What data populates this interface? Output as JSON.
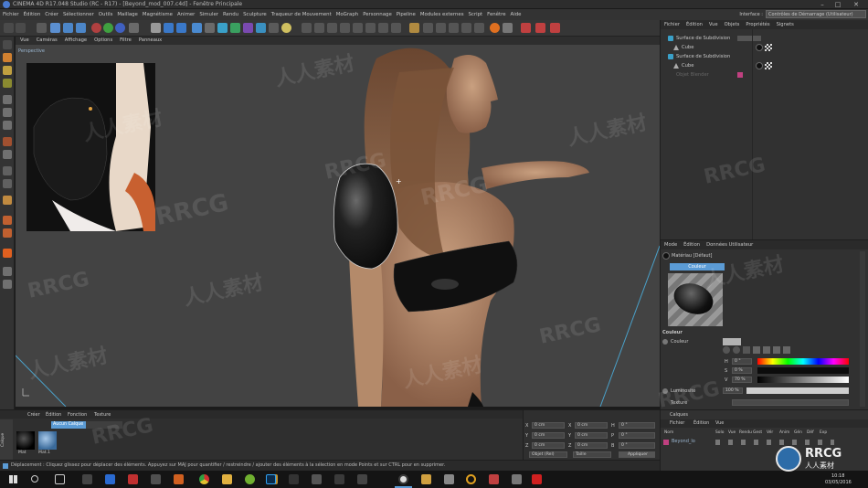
{
  "window": {
    "title": "CINEMA 4D R17.048 Studio (RC - R17) - [Beyond_mod_007.c4d] - Fenêtre Principale",
    "minimize": "–",
    "maximize": "□",
    "close": "✕"
  },
  "menu": {
    "items": [
      "Fichier",
      "Édition",
      "Créer",
      "Sélectionner",
      "Outils",
      "Maillage",
      "Magnétisme",
      "Animer",
      "Simuler",
      "Rendu",
      "Sculpture",
      "Traqueur de Mouvement",
      "MoGraph",
      "Personnage",
      "Pipeline",
      "Modules externes",
      "Script",
      "Fenêtre",
      "Aide"
    ],
    "interface_label": "Interface :",
    "interface_value": "Contrôles de Démarrage (Utilisateur)"
  },
  "viewport": {
    "menu": [
      "Vue",
      "Caméras",
      "Affichage",
      "Options",
      "Filtre",
      "Panneaux"
    ],
    "label": "Perspective"
  },
  "object_manager": {
    "tabs": [
      "Fichier",
      "Édition",
      "Vue",
      "Objets",
      "Propriétés",
      "Signets"
    ],
    "rows": [
      {
        "name": "Surface de Subdivision",
        "indent": 0
      },
      {
        "name": "Cube",
        "indent": 1
      },
      {
        "name": "Surface de Subdivision",
        "indent": 0
      },
      {
        "name": "Cube",
        "indent": 1
      },
      {
        "name": "Objet Blender",
        "indent": 0
      }
    ]
  },
  "attribute_manager": {
    "tabs": [
      "Mode",
      "Édition",
      "Données Utilisateur"
    ],
    "material_name": "Matériau [Défaut]",
    "channel_tab": "Couleur",
    "section": "Couleur",
    "color_label": "Couleur",
    "h_label": "H",
    "h_value": "0 °",
    "s_label": "S",
    "s_value": "0 %",
    "v_label": "V",
    "v_value": "70 %",
    "brightness_label": "Luminosité",
    "brightness_value": "100 %",
    "texture_label": "Texture"
  },
  "layers": {
    "section_label": "Calques",
    "tabs": [
      "Fichier",
      "Édition",
      "Vue"
    ],
    "columns": [
      "Nom",
      "Solo",
      "Vue",
      "Rendu",
      "Gest",
      "Vér",
      "Anim",
      "Gén",
      "Déf",
      "Exp"
    ],
    "row_name": "Beyond_lo"
  },
  "material_manager": {
    "tabs": [
      "Créer",
      "Édition",
      "Fonction",
      "Texture"
    ],
    "active_tab": "Aucun Calque",
    "materials": [
      {
        "name": "Mat",
        "color": "#1a1a1a"
      },
      {
        "name": "Mat.1",
        "color": "#3a6a9a"
      }
    ],
    "side_label": "Calque"
  },
  "coordinates": {
    "rows": [
      {
        "a_label": "X",
        "a_value": "0 cm",
        "b_label": "X",
        "b_value": "0 cm",
        "c_label": "H",
        "c_value": "0 °"
      },
      {
        "a_label": "Y",
        "a_value": "0 cm",
        "b_label": "Y",
        "b_value": "0 cm",
        "c_label": "P",
        "c_value": "0 °"
      },
      {
        "a_label": "Z",
        "a_value": "0 cm",
        "b_label": "Z",
        "b_value": "0 cm",
        "c_label": "B",
        "c_value": "0 °"
      }
    ],
    "mode_a": "Objet (Rel)",
    "mode_b": "Taille",
    "apply": "Appliquer"
  },
  "status": {
    "text": "Déplacement : Cliquez glissez pour déplacer des éléments. Appuyez sur MAJ pour quantifier / restreindre / ajouter des éléments à la sélection en mode Points et sur CTRL pour en supprimer."
  },
  "taskbar": {
    "time": "10:18",
    "date": "03/05/2016",
    "apps": [
      "search",
      "task-view",
      "chrome",
      "explorer",
      "utorrent",
      "file-manager",
      "photoshop",
      "media",
      "printer",
      "maxon",
      "cinema4d",
      "folder",
      "ring",
      "sticky",
      "pin",
      "red-app"
    ]
  },
  "watermark": {
    "brand": "RRCG",
    "cn": "人人素材",
    "logo_top": "RRCG",
    "logo_bottom": "人人素材"
  },
  "colors": {
    "viewport_bg": "#434343",
    "panel_bg": "#313131",
    "accent_blue": "#5b9bd5",
    "selection_blue": "#3a5f8a"
  }
}
